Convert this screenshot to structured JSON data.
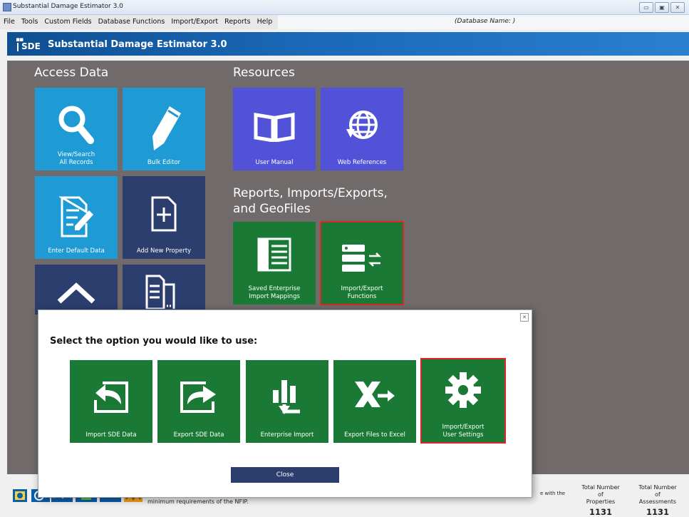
{
  "window": {
    "title": "Substantial Damage Estimator 3.0",
    "buttons": [
      "▭",
      "▣",
      "✕"
    ]
  },
  "menubar": {
    "items": [
      "File",
      "Tools",
      "Custom Fields",
      "Database Functions",
      "Import/Export",
      "Reports",
      "Help"
    ],
    "database_name": "(Database Name: )"
  },
  "banner": {
    "badge": "SDE",
    "title": "Substantial Damage Estimator 3.0"
  },
  "sections": {
    "access_data": "Access Data",
    "resources": "Resources",
    "reports_line1": "Reports, Imports/Exports,",
    "reports_line2": "and GeoFiles"
  },
  "tiles": {
    "view_search": {
      "line1": "View/Search",
      "line2": "All Records",
      "icon": "search-icon"
    },
    "bulk_editor": {
      "label": "Bulk Editor",
      "icon": "pencil-icon"
    },
    "enter_default": {
      "label": "Enter Default Data",
      "icon": "edit-document-icon"
    },
    "add_property": {
      "label": "Add New Property",
      "icon": "add-document-icon"
    },
    "house": {
      "icon": "house-icon"
    },
    "documents": {
      "icon": "documents-icon"
    },
    "user_manual": {
      "label": "User Manual",
      "icon": "book-icon"
    },
    "web_references": {
      "label": "Web References",
      "icon": "globe-icon"
    },
    "saved_mappings": {
      "line1": "Saved Enterprise",
      "line2": "Import Mappings",
      "icon": "layout-icon"
    },
    "import_export_functions": {
      "line1": "Import/Export",
      "line2": "Functions",
      "icon": "database-transfer-icon"
    }
  },
  "modal": {
    "prompt": "Select the option you would like to use:",
    "options": [
      {
        "label": "Import SDE Data",
        "icon": "import-icon"
      },
      {
        "label": "Export SDE Data",
        "icon": "export-icon"
      },
      {
        "label": "Enterprise Import",
        "icon": "enterprise-import-icon"
      },
      {
        "label": "Export Files to Excel",
        "icon": "excel-export-icon"
      },
      {
        "line1": "Import/Export",
        "line2": "User Settings",
        "icon": "gear-icon"
      }
    ],
    "close_label": "Close"
  },
  "footer": {
    "text": "minimum requirements of the NFIP.",
    "text_right": "e with the",
    "properties_label_1": "Total Number of",
    "properties_label_2": "Properties",
    "properties_count": "1131",
    "assessments_label_1": "Total Number of",
    "assessments_label_2": "Assessments",
    "assessments_count": "1131"
  },
  "colors": {
    "banner": "#1b69b8",
    "main_bg": "#716a6a",
    "tile_blue": "#1e9bd4",
    "tile_dark": "#2c3e6e",
    "tile_purple": "#5252d8",
    "tile_green": "#1a7a35",
    "highlight": "#d8262b"
  }
}
